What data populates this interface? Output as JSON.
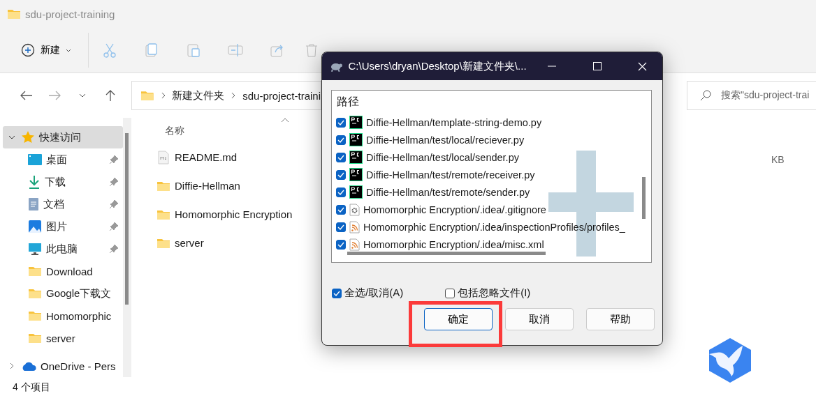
{
  "window": {
    "title": "sdu-project-training"
  },
  "toolbar": {
    "new_label": "新建"
  },
  "address_bar": {
    "breadcrumbs": [
      "新建文件夹",
      "sdu-project-traini"
    ]
  },
  "search": {
    "placeholder": "搜索\"sdu-project-trai"
  },
  "sidebar": {
    "items": [
      {
        "label": "快速访问",
        "kind": "star",
        "selected": true,
        "pinned": false,
        "expandable": true
      },
      {
        "label": "桌面",
        "kind": "desktop",
        "selected": false,
        "pinned": true,
        "expandable": false
      },
      {
        "label": "下载",
        "kind": "download",
        "selected": false,
        "pinned": true,
        "expandable": false
      },
      {
        "label": "文档",
        "kind": "document",
        "selected": false,
        "pinned": true,
        "expandable": false
      },
      {
        "label": "图片",
        "kind": "pictures",
        "selected": false,
        "pinned": true,
        "expandable": false
      },
      {
        "label": "此电脑",
        "kind": "computer",
        "selected": false,
        "pinned": true,
        "expandable": false
      },
      {
        "label": "Download",
        "kind": "folder",
        "selected": false,
        "pinned": false,
        "expandable": false
      },
      {
        "label": "Google下载文",
        "kind": "folder",
        "selected": false,
        "pinned": false,
        "expandable": false
      },
      {
        "label": "Homomorphic",
        "kind": "folder",
        "selected": false,
        "pinned": false,
        "expandable": false
      },
      {
        "label": "server",
        "kind": "folder",
        "selected": false,
        "pinned": false,
        "expandable": false
      },
      {
        "label": "OneDrive - Pers",
        "kind": "cloud",
        "selected": false,
        "pinned": false,
        "expandable": true
      }
    ]
  },
  "files": {
    "columns": [
      {
        "label": "名称"
      }
    ],
    "rows": [
      {
        "name": "README.md",
        "kind": "markdown",
        "size": "KB"
      },
      {
        "name": "Diffie-Hellman",
        "kind": "folder"
      },
      {
        "name": "Homomorphic Encryption",
        "kind": "folder"
      },
      {
        "name": "server",
        "kind": "folder"
      }
    ]
  },
  "status_bar": {
    "count": "4 个项目"
  },
  "dialog": {
    "title": "C:\\Users\\dryan\\Desktop\\新建文件夹\\...",
    "list_header": "路径",
    "items": [
      {
        "path": "Diffie-Hellman/template-string-demo.py",
        "kind": "pycharm",
        "checked": true
      },
      {
        "path": "Diffie-Hellman/test/local/reciever.py",
        "kind": "pycharm",
        "checked": true
      },
      {
        "path": "Diffie-Hellman/test/local/sender.py",
        "kind": "pycharm",
        "checked": true
      },
      {
        "path": "Diffie-Hellman/test/remote/receiver.py",
        "kind": "pycharm",
        "checked": true
      },
      {
        "path": "Diffie-Hellman/test/remote/sender.py",
        "kind": "pycharm",
        "checked": true
      },
      {
        "path": "Homomorphic Encryption/.idea/.gitignore",
        "kind": "settings",
        "checked": true
      },
      {
        "path": "Homomorphic Encryption/.idea/inspectionProfiles/profiles_",
        "kind": "feed",
        "checked": true
      },
      {
        "path": "Homomorphic Encryption/.idea/misc.xml",
        "kind": "feed",
        "checked": true
      }
    ],
    "options": [
      {
        "label": "全选/取消(A)",
        "checked": true
      },
      {
        "label": "包括忽略文件(I)",
        "checked": false
      }
    ],
    "buttons": [
      {
        "label": "确定",
        "default": true
      },
      {
        "label": "取消",
        "default": false
      },
      {
        "label": "帮助",
        "default": false
      }
    ]
  }
}
